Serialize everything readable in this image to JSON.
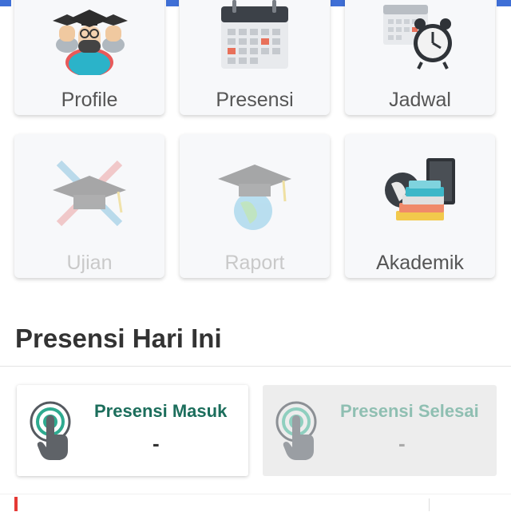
{
  "menu": {
    "row1": [
      {
        "label": "Profile",
        "icon": "graduates-icon",
        "enabled": true
      },
      {
        "label": "Presensi",
        "icon": "calendar-icon",
        "enabled": true
      },
      {
        "label": "Jadwal",
        "icon": "calendar-clock-icon",
        "enabled": true
      }
    ],
    "row2": [
      {
        "label": "Ujian",
        "icon": "exam-cap-pencils-icon",
        "enabled": false
      },
      {
        "label": "Raport",
        "icon": "graduation-globe-icon",
        "enabled": false
      },
      {
        "label": "Akademik",
        "icon": "globe-books-icon",
        "enabled": true
      }
    ]
  },
  "presensi": {
    "section_title": "Presensi Hari Ini",
    "masuk": {
      "title": "Presensi Masuk",
      "value": "-",
      "icon": "touch-finger-icon"
    },
    "selesai": {
      "title": "Presensi Selesai",
      "value": "-",
      "icon": "touch-finger-icon"
    }
  },
  "colors": {
    "accent_blue": "#3f6fd6",
    "green_dark": "#1c6e5c",
    "green_light": "#8fbfb2",
    "red_marker": "#e53935"
  }
}
